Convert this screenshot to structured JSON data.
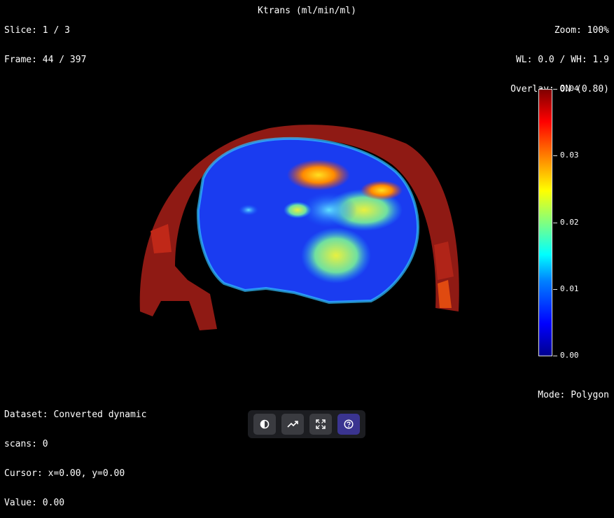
{
  "top_left": {
    "slice": "Slice: 1 / 3",
    "frame": "Frame: 44 / 397"
  },
  "top_center": {
    "title": "Ktrans (ml/min/ml)"
  },
  "top_right": {
    "zoom": "Zoom: 100%",
    "wl": "WL: 0.0 / WH: 1.9",
    "overlay": "Overlay: ON (0.80)"
  },
  "colorbar": {
    "ticks": [
      "0.04",
      "0.03",
      "0.02",
      "0.01",
      "0.00"
    ],
    "colors": [
      "#00008f",
      "#0000ff",
      "#0080ff",
      "#00ffff",
      "#80ff80",
      "#ffff00",
      "#ff8000",
      "#ff0000",
      "#800000"
    ]
  },
  "bottom_left": {
    "dataset": "Dataset: Converted dynamic",
    "scans": "scans: 0",
    "cursor": "Cursor: x=0.00, y=0.00",
    "value": "Value: 0.00"
  },
  "bottom_right": {
    "mode": "Mode: Polygon"
  },
  "toolbar": {
    "buttons": [
      {
        "icon": "contrast-icon",
        "active": false
      },
      {
        "icon": "trend-icon",
        "active": false
      },
      {
        "icon": "fullscreen-icon",
        "active": false
      },
      {
        "icon": "help-icon",
        "active": true
      }
    ]
  }
}
